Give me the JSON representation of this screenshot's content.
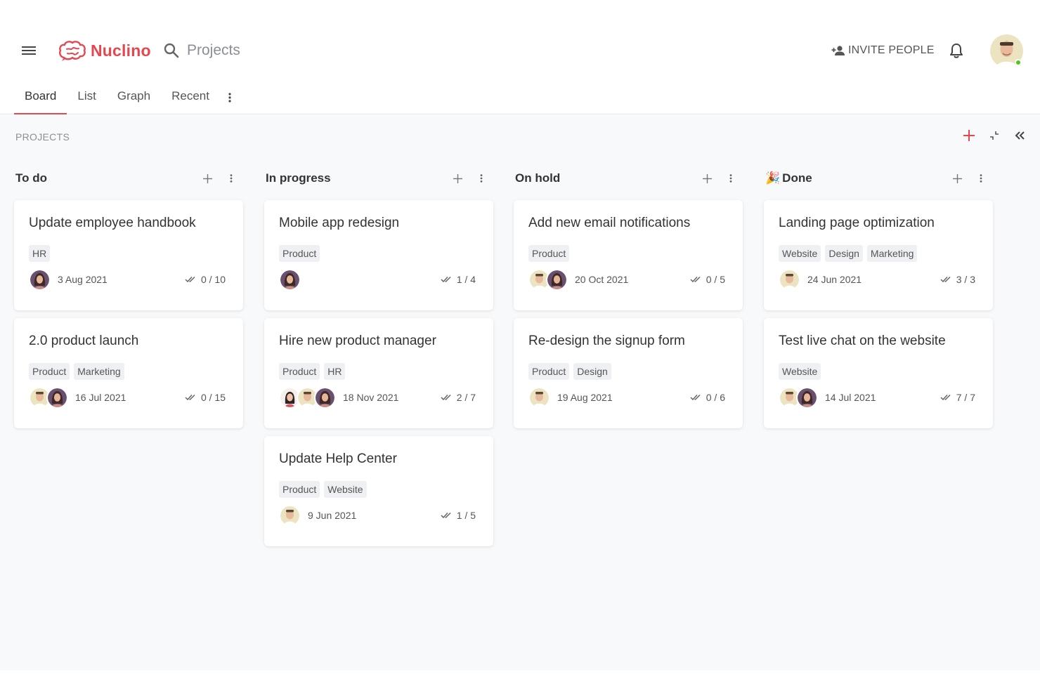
{
  "app": {
    "name": "Nuclino",
    "brand_color": "#e5474f"
  },
  "search": {
    "label": "Projects"
  },
  "header": {
    "invite_label": "INVITE PEOPLE"
  },
  "tabs": [
    {
      "label": "Board",
      "active": true
    },
    {
      "label": "List",
      "active": false
    },
    {
      "label": "Graph",
      "active": false
    },
    {
      "label": "Recent",
      "active": false
    }
  ],
  "board": {
    "section_title": "PROJECTS"
  },
  "columns": [
    {
      "title": "To do",
      "cards": [
        {
          "title": "Update employee handbook",
          "tags": [
            "HR"
          ],
          "avatars": [
            "woman"
          ],
          "date": "3 Aug 2021",
          "progress": "0 / 10"
        },
        {
          "title": "2.0 product launch",
          "tags": [
            "Product",
            "Marketing"
          ],
          "avatars": [
            "man",
            "woman"
          ],
          "date": "16 Jul 2021",
          "progress": "0 / 15"
        }
      ]
    },
    {
      "title": "In progress",
      "cards": [
        {
          "title": "Mobile app redesign",
          "tags": [
            "Product"
          ],
          "avatars": [
            "woman"
          ],
          "date": "",
          "progress": "1 / 4"
        },
        {
          "title": "Hire new product manager",
          "tags": [
            "Product",
            "HR"
          ],
          "avatars": [
            "girl",
            "man",
            "woman"
          ],
          "date": "18 Nov 2021",
          "progress": "2 / 7"
        },
        {
          "title": "Update Help Center",
          "tags": [
            "Product",
            "Website"
          ],
          "avatars": [
            "man"
          ],
          "date": "9 Jun 2021",
          "progress": "1 / 5"
        }
      ]
    },
    {
      "title": "On hold",
      "cards": [
        {
          "title": "Add new email notifications",
          "tags": [
            "Product"
          ],
          "avatars": [
            "man",
            "woman"
          ],
          "date": "20 Oct 2021",
          "progress": "0 / 5"
        },
        {
          "title": "Re-design the signup form",
          "tags": [
            "Product",
            "Design"
          ],
          "avatars": [
            "man"
          ],
          "date": "19 Aug 2021",
          "progress": "0 / 6"
        }
      ]
    },
    {
      "title": "Done",
      "emoji": "🎉",
      "cards": [
        {
          "title": "Landing page optimization",
          "tags": [
            "Website",
            "Design",
            "Marketing"
          ],
          "avatars": [
            "man"
          ],
          "date": "24 Jun 2021",
          "progress": "3 / 3"
        },
        {
          "title": "Test live chat on the website",
          "tags": [
            "Website"
          ],
          "avatars": [
            "man",
            "woman"
          ],
          "date": "14 Jul 2021",
          "progress": "7 / 7"
        }
      ]
    }
  ]
}
